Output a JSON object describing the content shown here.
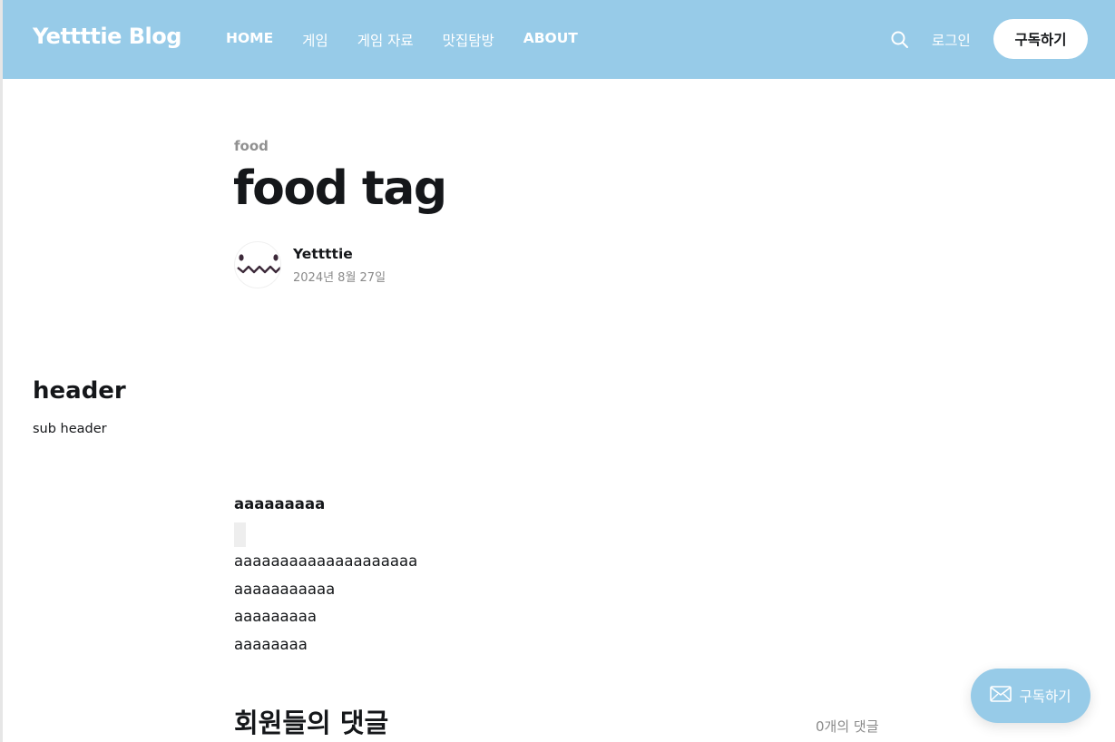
{
  "header": {
    "logo": "Yettttie Blog",
    "nav": [
      {
        "label": "HOME"
      },
      {
        "label": "게임"
      },
      {
        "label": "게임 자료"
      },
      {
        "label": "맛집탐방"
      },
      {
        "label": "ABOUT"
      }
    ],
    "search_icon": "search-icon",
    "login_label": "로그인",
    "subscribe_label": "구독하기"
  },
  "article": {
    "tag": "food",
    "title": "food tag",
    "author": "Yettttie",
    "date": "2024년 8월 27일"
  },
  "side": {
    "header": "header",
    "subheader": "sub header"
  },
  "content": {
    "bold_line": "aaaaaaaaa",
    "lines": [
      "aaaaaaaaaaaaaaaaaaaa",
      "aaaaaaaaaaa",
      "aaaaaaaaa",
      "aaaaaaaa"
    ]
  },
  "comments": {
    "title": "회원들의 댓글",
    "count": "0개의 댓글"
  },
  "floating": {
    "icon": "mail-icon",
    "label": "구독하기"
  },
  "colors": {
    "brand": "#97cbe8"
  }
}
